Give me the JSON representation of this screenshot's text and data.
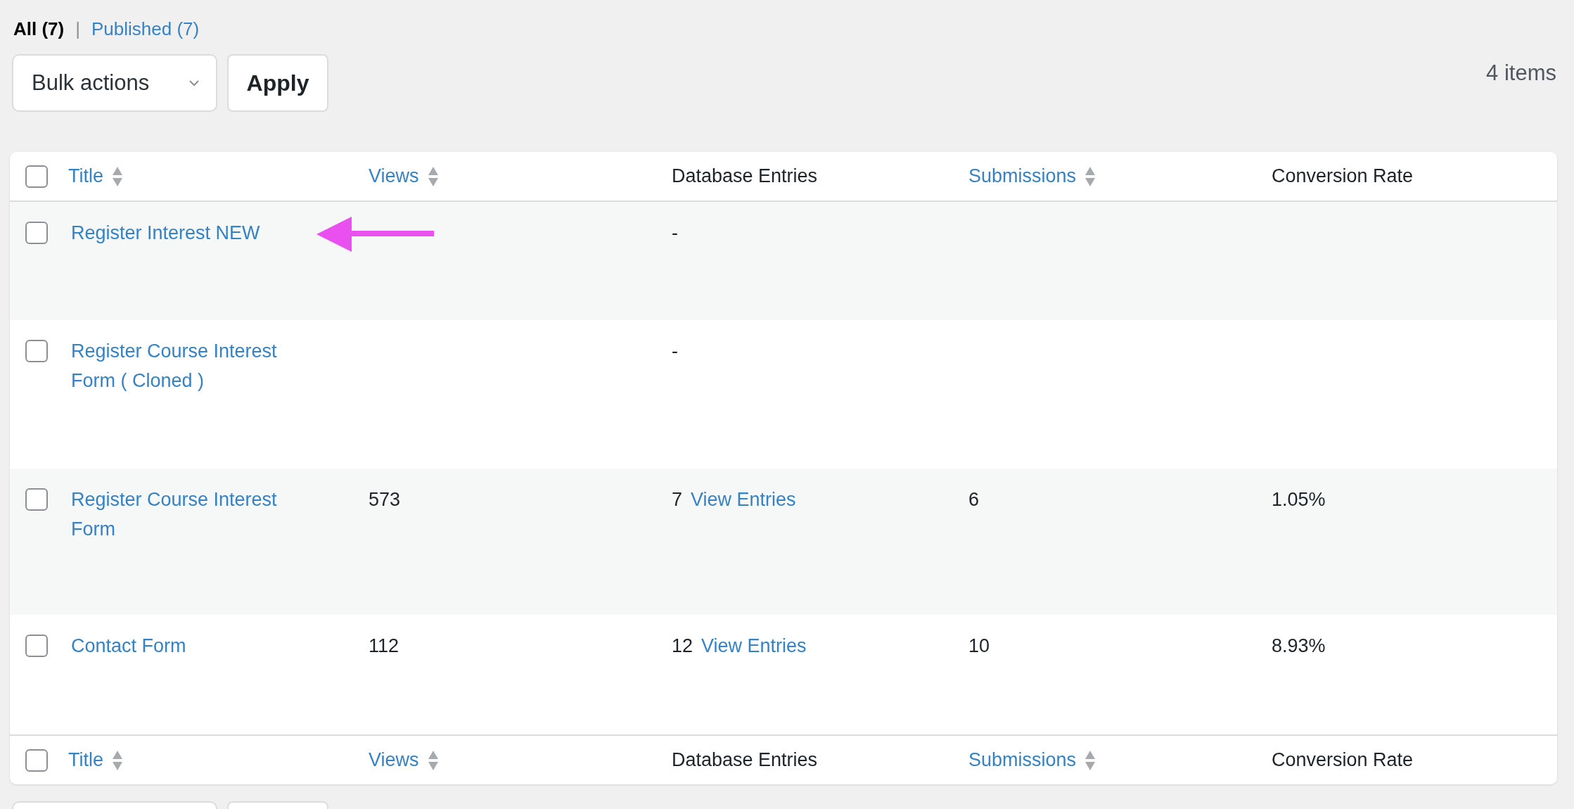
{
  "filters": [
    {
      "label": "All (7)",
      "selected": true
    },
    {
      "label": "Published (7)",
      "selected": false
    }
  ],
  "filter_separator": "|",
  "bulk_actions": {
    "value": "Bulk actions"
  },
  "apply_button": "Apply",
  "item_count": "4 items",
  "columns": [
    {
      "label": "Title",
      "sortable": true
    },
    {
      "label": "Views",
      "sortable": true
    },
    {
      "label": "Database Entries",
      "sortable": false
    },
    {
      "label": "Submissions",
      "sortable": true
    },
    {
      "label": "Conversion Rate",
      "sortable": false
    }
  ],
  "rows": [
    {
      "checked": false,
      "title": "Register Interest NEW",
      "views": "",
      "entries_count": "-",
      "entries_link": "",
      "submissions": "",
      "conversion_rate": "",
      "annotation_arrow": true
    },
    {
      "checked": false,
      "title": "Register Course Interest Form ( Cloned )",
      "views": "",
      "entries_count": "-",
      "entries_link": "",
      "submissions": "",
      "conversion_rate": "",
      "annotation_arrow": false
    },
    {
      "checked": false,
      "title": "Register Course Interest Form",
      "views": "573",
      "entries_count": "7",
      "entries_link": "View Entries",
      "submissions": "6",
      "conversion_rate": "1.05%",
      "annotation_arrow": false
    },
    {
      "checked": false,
      "title": "Contact Form",
      "views": "112",
      "entries_count": "12",
      "entries_link": "View Entries",
      "submissions": "10",
      "conversion_rate": "8.93%",
      "annotation_arrow": false
    }
  ],
  "select_all_checked": false,
  "footer_columns": [
    {
      "label": "Title",
      "sortable": true
    },
    {
      "label": "Views",
      "sortable": true
    },
    {
      "label": "Database Entries",
      "sortable": false
    },
    {
      "label": "Submissions",
      "sortable": true
    },
    {
      "label": "Conversion Rate",
      "sortable": false
    }
  ],
  "footer_select_all_checked": false
}
